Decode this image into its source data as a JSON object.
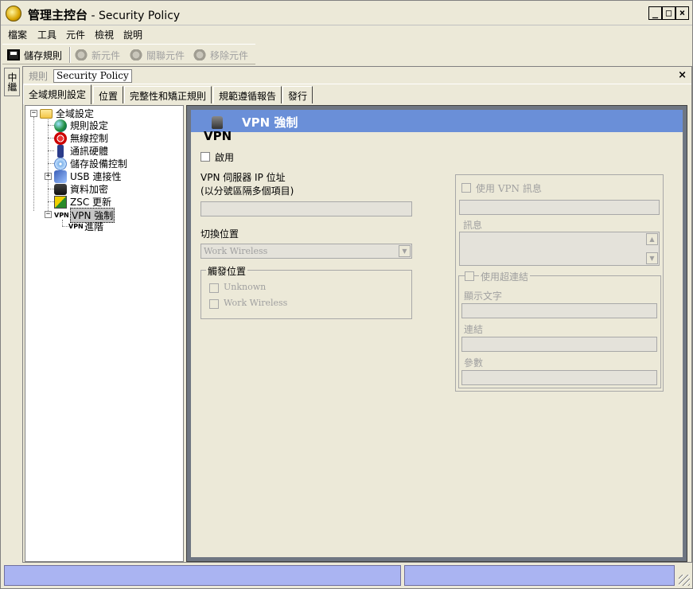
{
  "window": {
    "title_main": "管理主控台",
    "title_sep": " - ",
    "title_sub": "Security Policy",
    "btn_min": "_",
    "btn_max": "□",
    "btn_close": "×"
  },
  "menu": [
    "檔案",
    "工具",
    "元件",
    "檢視",
    "說明"
  ],
  "toolbar": {
    "save": "儲存規則",
    "new_component": "新元件",
    "associate_component": "關聯元件",
    "remove_component": "移除元件"
  },
  "sidetab": "中繼",
  "doc_tabs": {
    "policy": "規則",
    "security_policy": "Security Policy",
    "close": "×"
  },
  "page_tabs": [
    "全域規則設定",
    "位置",
    "完整性和矯正規則",
    "規範遵循報告",
    "發行"
  ],
  "tree": {
    "root": "全域設定",
    "items": [
      "規則設定",
      "無線控制",
      "通訊硬體",
      "儲存設備控制",
      "USB 連接性",
      "資料加密",
      "ZSC 更新",
      "VPN 強制"
    ],
    "child": "進階",
    "vpn_icon_text": "VPN",
    "expander_minus": "−",
    "expander_plus": "+"
  },
  "vpn": {
    "header_title": "VPN 強制",
    "badge_text": "VPN",
    "enable_label": "啟用",
    "server_ip_label": "VPN 伺服器 IP 位址",
    "server_ip_hint": "(以分號區隔多個項目)",
    "server_ip_value": "",
    "switch_location_label": "切換位置",
    "switch_location_value": "Work Wireless",
    "trigger_group_title": "觸發位置",
    "trigger_options": [
      "Unknown",
      "Work Wireless"
    ],
    "use_vpn_message": "使用 VPN 訊息",
    "message_title_value": "",
    "message_label": "訊息",
    "use_hyperlink": "使用超連結",
    "display_text_label": "顯示文字",
    "link_label": "連結",
    "params_label": "參數"
  },
  "colors": {
    "header_blue": "#6a8fd8",
    "status_panel": "#aab4f2"
  }
}
